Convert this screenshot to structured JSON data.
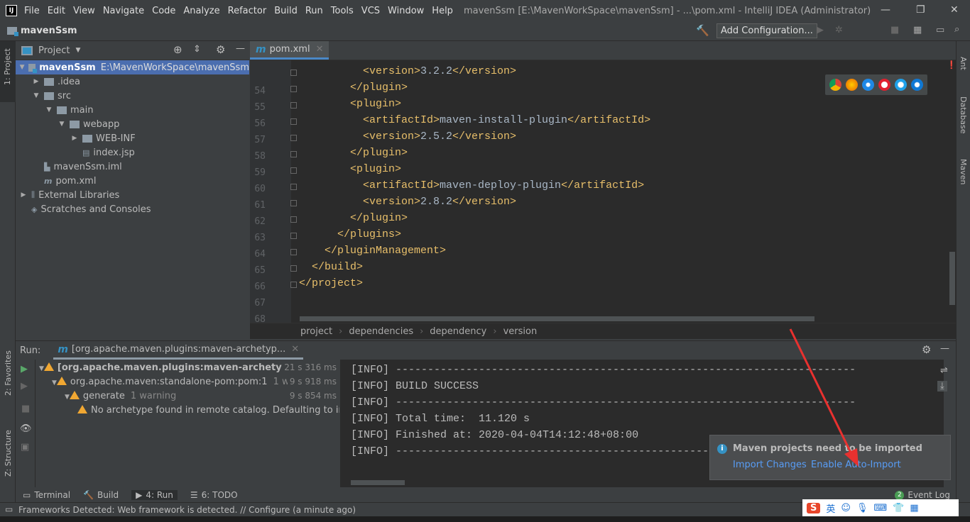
{
  "window": {
    "title": "mavenSsm [E:\\MavenWorkSpace\\mavenSsm] - ...\\pom.xml - IntelliJ IDEA (Administrator)"
  },
  "menu": [
    "File",
    "Edit",
    "View",
    "Navigate",
    "Code",
    "Analyze",
    "Refactor",
    "Build",
    "Run",
    "Tools",
    "VCS",
    "Window",
    "Help"
  ],
  "navbar": {
    "project": "mavenSsm",
    "add_config": "Add Configuration..."
  },
  "left_stripe": {
    "project": "1: Project",
    "favorites": "2: Favorites",
    "structure": "Z: Structure"
  },
  "project_panel": {
    "title": "Project",
    "tree": [
      {
        "label": "mavenSsm",
        "path": "E:\\MavenWorkSpace\\mavenSsm",
        "depth": 0,
        "icon": "module-folder",
        "expanded": true,
        "selected": true
      },
      {
        "label": ".idea",
        "depth": 1,
        "icon": "folder",
        "expanded": false
      },
      {
        "label": "src",
        "depth": 1,
        "icon": "folder",
        "expanded": true
      },
      {
        "label": "main",
        "depth": 2,
        "icon": "folder",
        "expanded": true
      },
      {
        "label": "webapp",
        "depth": 3,
        "icon": "folder",
        "expanded": true
      },
      {
        "label": "WEB-INF",
        "depth": 4,
        "icon": "folder",
        "expanded": false
      },
      {
        "label": "index.jsp",
        "depth": 4,
        "icon": "jsp-file"
      },
      {
        "label": "mavenSsm.iml",
        "depth": 1,
        "icon": "iml-file"
      },
      {
        "label": "pom.xml",
        "depth": 1,
        "icon": "maven-file"
      },
      {
        "label": "External Libraries",
        "depth": 0,
        "icon": "library",
        "expanded": false
      },
      {
        "label": "Scratches and Consoles",
        "depth": 0,
        "icon": "scratches"
      }
    ]
  },
  "editor": {
    "tab": "pom.xml",
    "lines": [
      {
        "n": "54",
        "indent": 5,
        "tag": "<version>",
        "text": "3.2.2",
        "close": "</version>"
      },
      {
        "n": "55",
        "indent": 4,
        "tag": "</plugin>"
      },
      {
        "n": "56",
        "indent": 4,
        "tag": "<plugin>"
      },
      {
        "n": "57",
        "indent": 5,
        "tag": "<artifactId>",
        "text": "maven-install-plugin",
        "close": "</artifactId>"
      },
      {
        "n": "58",
        "indent": 5,
        "tag": "<version>",
        "text": "2.5.2",
        "close": "</version>"
      },
      {
        "n": "59",
        "indent": 4,
        "tag": "</plugin>"
      },
      {
        "n": "60",
        "indent": 4,
        "tag": "<plugin>"
      },
      {
        "n": "61",
        "indent": 5,
        "tag": "<artifactId>",
        "text": "maven-deploy-plugin",
        "close": "</artifactId>"
      },
      {
        "n": "62",
        "indent": 5,
        "tag": "<version>",
        "text": "2.8.2",
        "close": "</version>"
      },
      {
        "n": "63",
        "indent": 4,
        "tag": "</plugin>"
      },
      {
        "n": "64",
        "indent": 3,
        "tag": "</plugins>"
      },
      {
        "n": "65",
        "indent": 2,
        "tag": "</pluginManagement>"
      },
      {
        "n": "66",
        "indent": 1,
        "tag": "</build>"
      },
      {
        "n": "67",
        "indent": 0,
        "tag": "</project>"
      },
      {
        "n": "68",
        "indent": 0,
        "tag": ""
      }
    ],
    "breadcrumbs": [
      "project",
      "dependencies",
      "dependency",
      "version"
    ],
    "browsers": [
      "chrome",
      "firefox",
      "safari",
      "opera",
      "ie",
      "edge"
    ]
  },
  "right_stripe": {
    "ant": "Ant",
    "database": "Database",
    "maven": "Maven"
  },
  "run": {
    "label": "Run:",
    "tab": "[org.apache.maven.plugins:maven-archetyp...",
    "tree": [
      {
        "label": "[org.apache.maven.plugins:maven-archetype-plugin:",
        "extra": "",
        "time": "21 s 316 ms",
        "bold": true
      },
      {
        "label": "org.apache.maven:standalone-pom:pom:1",
        "extra": "1 warning",
        "time": "9 s 918 ms"
      },
      {
        "label": "generate",
        "extra": "1 warning",
        "time": "9 s 854 ms"
      },
      {
        "label": "No archetype found in remote catalog. Defaulting to inter",
        "extra": "",
        "time": ""
      }
    ],
    "console": [
      "[INFO] ------------------------------------------------------------------------",
      "[INFO] BUILD SUCCESS",
      "[INFO] ------------------------------------------------------------------------",
      "[INFO] Total time:  11.120 s",
      "[INFO] Finished at: 2020-04-04T14:12:48+08:00",
      "[INFO] ------------------------------------------------------------------------"
    ]
  },
  "notification": {
    "title": "Maven projects need to be imported",
    "import": "Import Changes",
    "auto": "Enable Auto-Import"
  },
  "bottom_tools": {
    "terminal": "Terminal",
    "build": "Build",
    "run": "4: Run",
    "todo": "6: TODO",
    "event_count": "2",
    "event_log": "Event Log"
  },
  "status": {
    "text": "Frameworks Detected: Web framework is detected. // Configure (a minute ago)"
  },
  "colors": {
    "selection": "#4b6eaf",
    "tag": "#e8bf6a",
    "link": "#589df6",
    "warning": "#f0a732",
    "arrow": "#e8312f"
  }
}
